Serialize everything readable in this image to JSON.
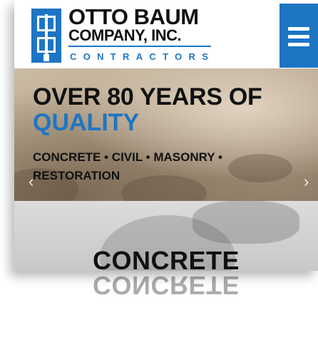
{
  "header": {
    "logo": {
      "line1": "OTTO BAUM",
      "line2": "COMPANY, INC.",
      "tagline": "CONTRACTORS",
      "mark_icon": "otto-baum-logo-mark"
    },
    "menu_icon": "hamburger-menu-icon"
  },
  "hero": {
    "title": "OVER 80 YEARS OF",
    "accent": "QUALITY",
    "subtitle": "CONCRETE • CIVIL • MASONRY • RESTORATION",
    "prev_icon": "chevron-left-icon",
    "next_icon": "chevron-right-icon",
    "prev_glyph": "‹",
    "next_glyph": "›"
  },
  "section": {
    "title": "CONCRETE"
  },
  "colors": {
    "brand_blue": "#1d75c4",
    "text_dark": "#111111",
    "header_bg": "#ffffff"
  }
}
